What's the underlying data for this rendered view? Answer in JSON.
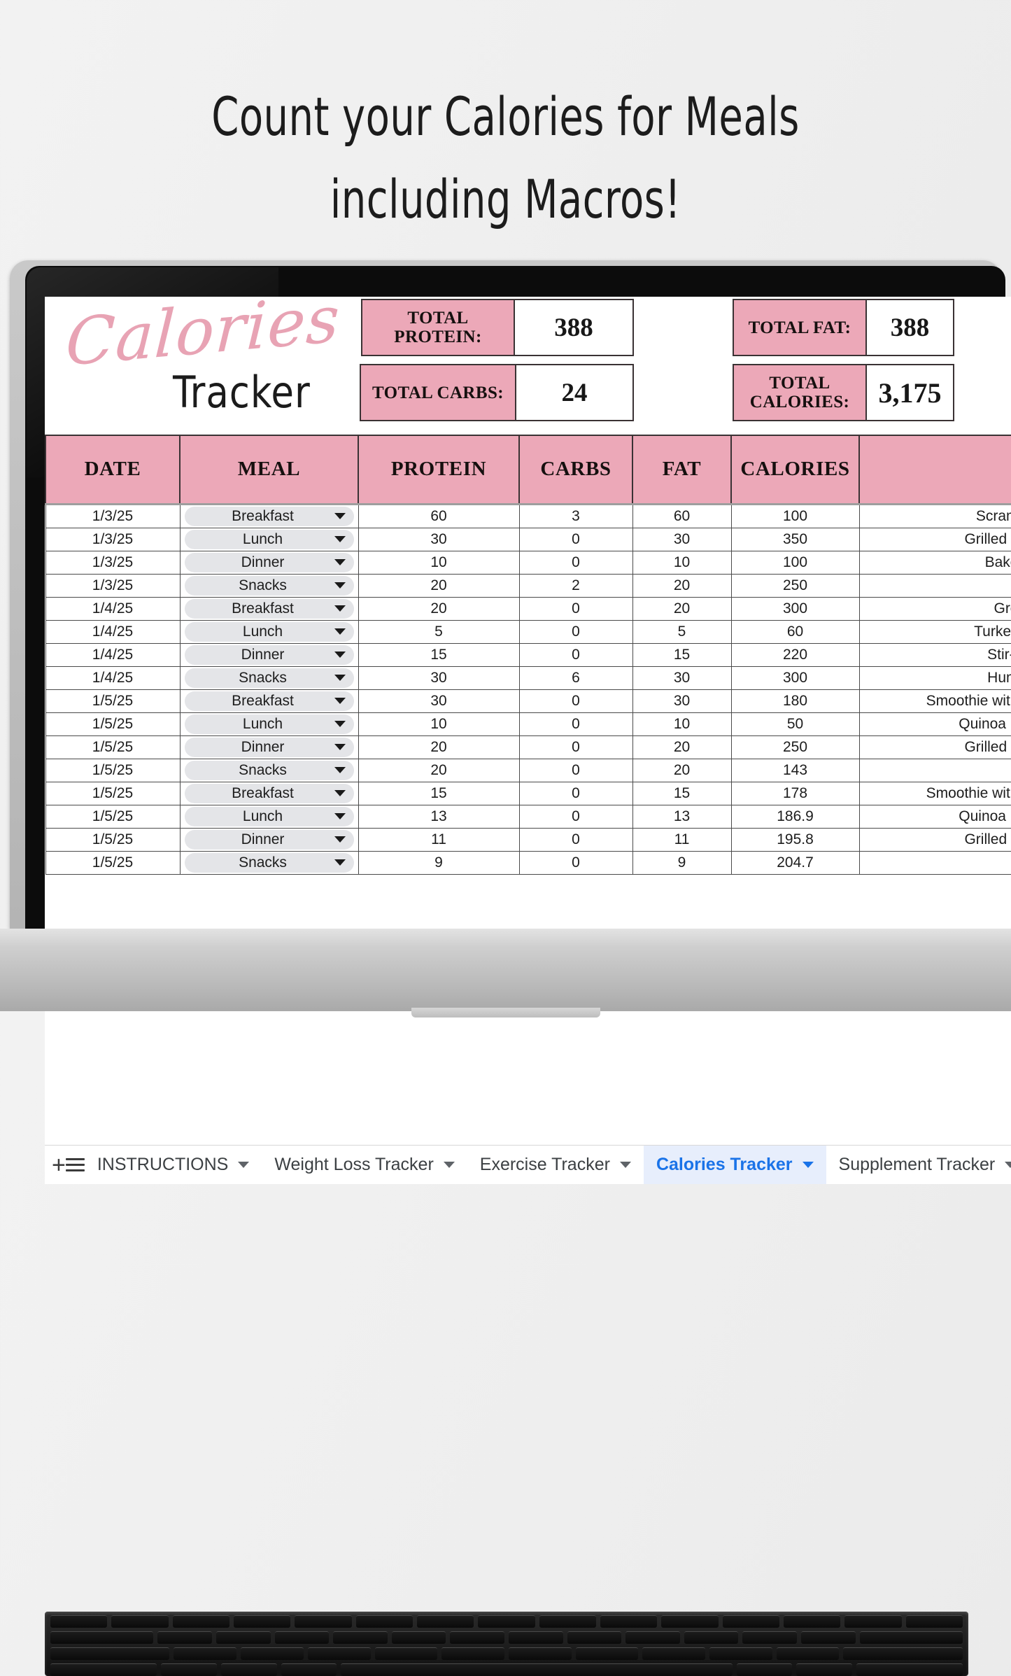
{
  "headline": {
    "line1": "Count your Calories for Meals",
    "line2": "including Macros!"
  },
  "logo": {
    "script": "Calories",
    "sub": "Tracker"
  },
  "colors": {
    "pink": "#eca8b8",
    "accent_blue": "#1a73e8",
    "script_pink": "#e8a3b4"
  },
  "summary": [
    {
      "name": "total-protein",
      "label": "TOTAL PROTEIN:",
      "value": "388"
    },
    {
      "name": "total-carbs",
      "label": "TOTAL CARBS:",
      "value": "24"
    },
    {
      "name": "total-fat",
      "label": "TOTAL FAT:",
      "value": "388"
    },
    {
      "name": "total-calories",
      "label": "TOTAL CALORIES:",
      "value": "3,175"
    }
  ],
  "table": {
    "headers": [
      "DATE",
      "MEAL",
      "PROTEIN",
      "CARBS",
      "FAT",
      "CALORIES",
      ""
    ],
    "rows": [
      {
        "date": "1/3/25",
        "meal": "Breakfast",
        "protein": "60",
        "carbs": "3",
        "fat": "60",
        "calories": "100",
        "notes": "Scram"
      },
      {
        "date": "1/3/25",
        "meal": "Lunch",
        "protein": "30",
        "carbs": "0",
        "fat": "30",
        "calories": "350",
        "notes": "Grilled c"
      },
      {
        "date": "1/3/25",
        "meal": "Dinner",
        "protein": "10",
        "carbs": "0",
        "fat": "10",
        "calories": "100",
        "notes": "Bake"
      },
      {
        "date": "1/3/25",
        "meal": "Snacks",
        "protein": "20",
        "carbs": "2",
        "fat": "20",
        "calories": "250",
        "notes": ""
      },
      {
        "date": "1/4/25",
        "meal": "Breakfast",
        "protein": "20",
        "carbs": "0",
        "fat": "20",
        "calories": "300",
        "notes": "Gre"
      },
      {
        "date": "1/4/25",
        "meal": "Lunch",
        "protein": "5",
        "carbs": "0",
        "fat": "5",
        "calories": "60",
        "notes": "Turkey"
      },
      {
        "date": "1/4/25",
        "meal": "Dinner",
        "protein": "15",
        "carbs": "0",
        "fat": "15",
        "calories": "220",
        "notes": "Stir-f"
      },
      {
        "date": "1/4/25",
        "meal": "Snacks",
        "protein": "30",
        "carbs": "6",
        "fat": "30",
        "calories": "300",
        "notes": "Hum"
      },
      {
        "date": "1/5/25",
        "meal": "Breakfast",
        "protein": "30",
        "carbs": "0",
        "fat": "30",
        "calories": "180",
        "notes": "Smoothie with"
      },
      {
        "date": "1/5/25",
        "meal": "Lunch",
        "protein": "10",
        "carbs": "0",
        "fat": "10",
        "calories": "50",
        "notes": "Quinoa b"
      },
      {
        "date": "1/5/25",
        "meal": "Dinner",
        "protein": "20",
        "carbs": "0",
        "fat": "20",
        "calories": "250",
        "notes": "Grilled c"
      },
      {
        "date": "1/5/25",
        "meal": "Snacks",
        "protein": "20",
        "carbs": "0",
        "fat": "20",
        "calories": "143",
        "notes": ""
      },
      {
        "date": "1/5/25",
        "meal": "Breakfast",
        "protein": "15",
        "carbs": "0",
        "fat": "15",
        "calories": "178",
        "notes": "Smoothie with"
      },
      {
        "date": "1/5/25",
        "meal": "Lunch",
        "protein": "13",
        "carbs": "0",
        "fat": "13",
        "calories": "186.9",
        "notes": "Quinoa b"
      },
      {
        "date": "1/5/25",
        "meal": "Dinner",
        "protein": "11",
        "carbs": "0",
        "fat": "11",
        "calories": "195.8",
        "notes": "Grilled c"
      },
      {
        "date": "1/5/25",
        "meal": "Snacks",
        "protein": "9",
        "carbs": "0",
        "fat": "9",
        "calories": "204.7",
        "notes": ""
      }
    ]
  },
  "tabbar": {
    "add_label": "+",
    "tabs": [
      {
        "label": "INSTRUCTIONS",
        "active": false
      },
      {
        "label": "Weight Loss Tracker",
        "active": false
      },
      {
        "label": "Exercise Tracker",
        "active": false
      },
      {
        "label": "Calories Tracker",
        "active": true
      },
      {
        "label": "Supplement Tracker",
        "active": false
      }
    ]
  }
}
